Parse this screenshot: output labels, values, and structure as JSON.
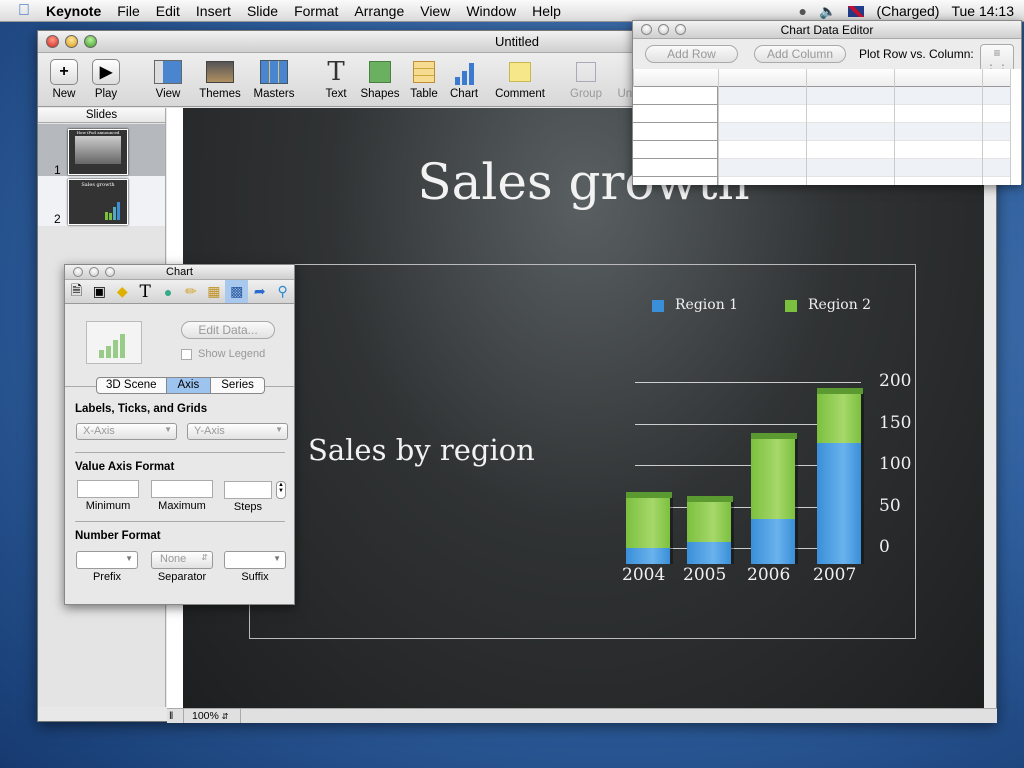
{
  "menubar": {
    "app": "Keynote",
    "items": [
      "File",
      "Edit",
      "Insert",
      "Slide",
      "Format",
      "Arrange",
      "View",
      "Window",
      "Help"
    ],
    "battery": "(Charged)",
    "clock": "Tue 14:13"
  },
  "window": {
    "title": "Untitled"
  },
  "toolbar": {
    "new": "New",
    "play": "Play",
    "view": "View",
    "themes": "Themes",
    "masters": "Masters",
    "text": "Text",
    "shapes": "Shapes",
    "table": "Table",
    "chart": "Chart",
    "comment": "Comment",
    "group": "Group",
    "ungroup": "Ung"
  },
  "slides_pane": {
    "header": "Slides",
    "slides": [
      {
        "num": "1",
        "title": "How iPod announced"
      },
      {
        "num": "2",
        "title": "Sales growth"
      }
    ]
  },
  "slide": {
    "title": "Sales growth",
    "subtitle": "Sales by region"
  },
  "zoom": "100%",
  "chart_data": {
    "type": "bar",
    "stacked": true,
    "three_d": true,
    "categories": [
      "2004",
      "2005",
      "2006",
      "2007"
    ],
    "series": [
      {
        "name": "Region 1",
        "color": "#3a8fd8",
        "values": [
          18,
          25,
          50,
          135
        ]
      },
      {
        "name": "Region 2",
        "color": "#7cc040",
        "values": [
          57,
          45,
          90,
          55
        ]
      }
    ],
    "yticks": [
      "0",
      "50",
      "100",
      "150",
      "200"
    ],
    "ylim": [
      0,
      200
    ],
    "legend": "top",
    "grid": true
  },
  "chart_data_editor": {
    "title": "Chart Data Editor",
    "add_row": "Add Row",
    "add_column": "Add Column",
    "plot_label": "Plot Row vs. Column:"
  },
  "inspector": {
    "title": "Chart",
    "edit_data": "Edit Data...",
    "show_legend": "Show Legend",
    "tabs": [
      "3D Scene",
      "Axis",
      "Series"
    ],
    "active_tab": "Axis",
    "labels_section": "Labels, Ticks, and Grids",
    "x_axis": "X-Axis",
    "y_axis": "Y-Axis",
    "value_section": "Value Axis Format",
    "minimum": "Minimum",
    "maximum": "Maximum",
    "steps": "Steps",
    "number_section": "Number Format",
    "prefix": "Prefix",
    "separator": "Separator",
    "separator_value": "None",
    "suffix": "Suffix"
  }
}
